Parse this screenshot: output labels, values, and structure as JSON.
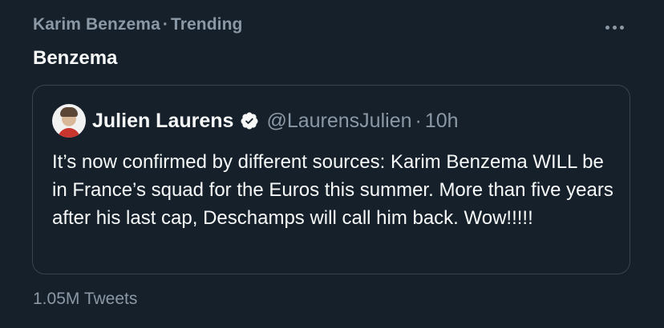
{
  "trend": {
    "context_name": "Karim Benzema",
    "context_separator": "·",
    "context_label": "Trending",
    "title": "Benzema",
    "tweet_count": "1.05M Tweets",
    "more_icon": "more-horizontal-icon"
  },
  "quoted_tweet": {
    "author_name": "Julien Laurens",
    "verified_icon": "verified-badge-icon",
    "handle": "@LaurensJulien",
    "separator": "·",
    "time": "10h",
    "text": "It’s now confirmed by different sources: Karim Benzema WILL be in France’s squad for the Euros this summer. More than five years after his last cap, Deschamps will call him back. Wow!!!!!"
  },
  "colors": {
    "background": "#15202b",
    "primary_text": "#f7f9f9",
    "secondary_text": "#8b98a5",
    "border": "#38444d"
  }
}
